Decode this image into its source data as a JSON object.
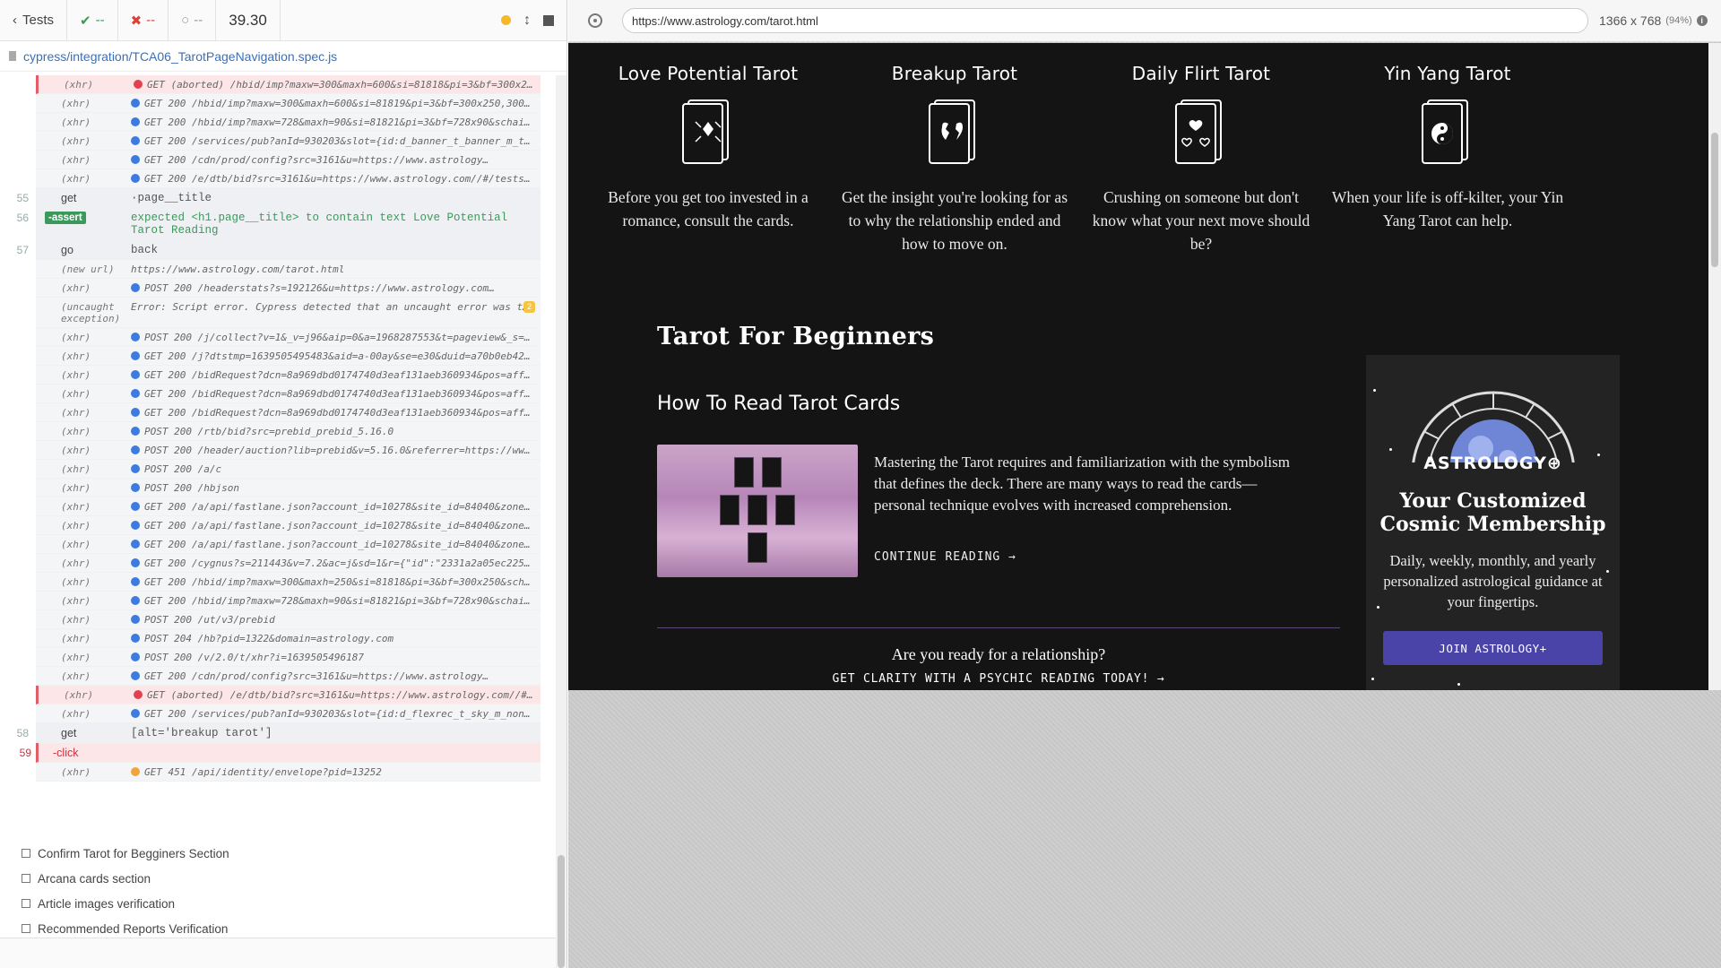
{
  "runner": {
    "back_label": "Tests",
    "passed": "--",
    "failed": "--",
    "pending": "--",
    "duration": "39.30",
    "spec_path": "cypress/integration/TCA06_TarotPageNavigation.spec.js"
  },
  "log": [
    {
      "num": "",
      "name": "(xhr)",
      "status": "red",
      "msg": "GET (aborted) /hbid/imp?maxw=300&maxh=600&si=81818&pi=3&bf=300x250,30…",
      "kind": "err"
    },
    {
      "num": "",
      "name": "(xhr)",
      "status": "blue",
      "msg": "GET 200 /hbid/imp?maxw=300&maxh=600&si=81819&pi=3&bf=300x250,300x600&…"
    },
    {
      "num": "",
      "name": "(xhr)",
      "status": "blue",
      "msg": "GET 200 /hbid/imp?maxw=728&maxh=90&si=81821&pi=3&bf=728x90&schain=1.0…"
    },
    {
      "num": "",
      "name": "(xhr)",
      "status": "blue",
      "msg": "GET 200 /services/pub?anId=930203&slot={id:d_banner_t_banner_m_tinyba…"
    },
    {
      "num": "",
      "name": "(xhr)",
      "status": "blue",
      "msg": "GET 200 /cdn/prod/config?src=3161&u=https://www.astrology…"
    },
    {
      "num": "",
      "name": "(xhr)",
      "status": "blue",
      "msg": "GET 200 /e/dtb/bid?src=3161&u=https://www.astrology.com//#/tests/inte…"
    },
    {
      "num": "55",
      "name": "get",
      "msg": "·page__title",
      "kind": "cmd"
    },
    {
      "num": "56",
      "name": "-assert",
      "msg": "expected <h1.page__title> to contain text Love Potential Tarot Reading",
      "kind": "assert"
    },
    {
      "num": "57",
      "name": "go",
      "msg": "back",
      "kind": "cmd"
    },
    {
      "num": "",
      "name": "(new url)",
      "status": "",
      "msg": "https://www.astrology.com/tarot.html",
      "kind": "url"
    },
    {
      "num": "",
      "name": "(xhr)",
      "status": "blue",
      "msg": "POST 200 /headerstats?s=192126&u=https://www.astrology.com…"
    },
    {
      "num": "",
      "name": "(uncaught exception)",
      "status": "",
      "msg": "Error: Script error. Cypress detected that an uncaught error was throw…",
      "count": "2",
      "kind": "exc"
    },
    {
      "num": "",
      "name": "(xhr)",
      "status": "blue",
      "msg": "POST 200 /j/collect?v=1&_v=j96&aip=0&a=1968287553&t=pageview&_s=1&dl=…"
    },
    {
      "num": "",
      "name": "(xhr)",
      "status": "blue",
      "msg": "GET 200 /j?dtstmp=1639505495483&aid=a-00ay&se=e30&duid=a70b0eb4253c-…"
    },
    {
      "num": "",
      "name": "(xhr)",
      "status": "blue",
      "msg": "GET 200 /bidRequest?dcn=8a969dbd0174740d3eaf131aeb360934&pos=affiliat…"
    },
    {
      "num": "",
      "name": "(xhr)",
      "status": "blue",
      "msg": "GET 200 /bidRequest?dcn=8a969dbd0174740d3eaf131aeb360934&pos=affiliat…"
    },
    {
      "num": "",
      "name": "(xhr)",
      "status": "blue",
      "msg": "GET 200 /bidRequest?dcn=8a969dbd0174740d3eaf131aeb360934&pos=affiliat…"
    },
    {
      "num": "",
      "name": "(xhr)",
      "status": "blue",
      "msg": "POST 200 /rtb/bid?src=prebid_prebid_5.16.0"
    },
    {
      "num": "",
      "name": "(xhr)",
      "status": "blue",
      "msg": "POST 200 /header/auction?lib=prebid&v=5.16.0&referrer=https://www.ast…"
    },
    {
      "num": "",
      "name": "(xhr)",
      "status": "blue",
      "msg": "POST 200 /a/c"
    },
    {
      "num": "",
      "name": "(xhr)",
      "status": "blue",
      "msg": "POST 200 /hbjson"
    },
    {
      "num": "",
      "name": "(xhr)",
      "status": "blue",
      "msg": "GET 200 /a/api/fastlane.json?account_id=10278&site_id=84040&zone_id=7…"
    },
    {
      "num": "",
      "name": "(xhr)",
      "status": "blue",
      "msg": "GET 200 /a/api/fastlane.json?account_id=10278&site_id=84040&zone_id=7…"
    },
    {
      "num": "",
      "name": "(xhr)",
      "status": "blue",
      "msg": "GET 200 /a/api/fastlane.json?account_id=10278&site_id=84040&zone_id=7…"
    },
    {
      "num": "",
      "name": "(xhr)",
      "status": "blue",
      "msg": "GET 200 /cygnus?s=211443&v=7.2&ac=j&sd=1&r={\"id\":\"2331a2a05ec2258\",\"s…"
    },
    {
      "num": "",
      "name": "(xhr)",
      "status": "blue",
      "msg": "GET 200 /hbid/imp?maxw=300&maxh=250&si=81818&pi=3&bf=300x250&schain=1…"
    },
    {
      "num": "",
      "name": "(xhr)",
      "status": "blue",
      "msg": "GET 200 /hbid/imp?maxw=728&maxh=90&si=81821&pi=3&bf=728x90&schain=1.0…"
    },
    {
      "num": "",
      "name": "(xhr)",
      "status": "blue",
      "msg": "POST 200 /ut/v3/prebid"
    },
    {
      "num": "",
      "name": "(xhr)",
      "status": "blue",
      "msg": "POST 204 /hb?pid=1322&domain=astrology.com"
    },
    {
      "num": "",
      "name": "(xhr)",
      "status": "blue",
      "msg": "POST 200 /v/2.0/t/xhr?i=1639505496187"
    },
    {
      "num": "",
      "name": "(xhr)",
      "status": "blue",
      "msg": "GET 200 /cdn/prod/config?src=3161&u=https://www.astrology…"
    },
    {
      "num": "",
      "name": "(xhr)",
      "status": "red",
      "msg": "GET (aborted) /e/dtb/bid?src=3161&u=https://www.astrology.com//#/test…",
      "kind": "err"
    },
    {
      "num": "",
      "name": "(xhr)",
      "status": "blue",
      "msg": "GET 200 /services/pub?anId=930203&slot={id:d_flexrec_t_sky_m_none_1,s…"
    },
    {
      "num": "58",
      "name": "get",
      "msg": "[alt='breakup tarot']",
      "kind": "cmd"
    },
    {
      "num": "59",
      "name": "-click",
      "msg": "",
      "kind": "click"
    },
    {
      "num": "",
      "name": "(xhr)",
      "status": "orange",
      "msg": "GET 451 /api/identity/envelope?pid=13252"
    }
  ],
  "tests": [
    "Confirm Tarot for Begginers Section",
    "Arcana cards section",
    "Article images verification",
    "Recommended Reports Verification"
  ],
  "browser": {
    "url": "https://www.astrology.com/tarot.html",
    "viewport": "1366 x 768",
    "scale": "(94%)"
  },
  "page": {
    "cards": [
      {
        "title": "Love Potential Tarot",
        "desc": "Before you get too invested in a romance, consult the cards.",
        "icon": "love-tarot-card-icon"
      },
      {
        "title": "Breakup Tarot",
        "desc": "Get the insight you're looking for as to why the relationship ended and how to move on.",
        "icon": "breakup-tarot-card-icon"
      },
      {
        "title": "Daily Flirt Tarot",
        "desc": "Crushing on someone but don't know what your next move should be?",
        "icon": "flirt-tarot-card-icon"
      },
      {
        "title": "Yin Yang Tarot",
        "desc": "When your life is off-kilter, your Yin Yang Tarot can help.",
        "icon": "yin-yang-tarot-card-icon"
      }
    ],
    "section_title": "Tarot For Beginners",
    "article": {
      "title": "How To Read Tarot Cards",
      "text": "Mastering the Tarot requires and familiarization with the symbolism that defines the deck. There are many ways to read the cards—personal technique evolves with increased comprehension.",
      "cta": "CONTINUE READING →"
    },
    "ready_text": "Are you ready for a relationship?",
    "clarity_link": "GET CLARITY WITH A PSYCHIC READING TODAY! →",
    "promo": {
      "brand": "ASTROLOGY⊕",
      "title": "Your Customized Cosmic Membership",
      "text": "Daily, weekly, monthly, and yearly personalized astrological guidance at your fingertips.",
      "button": "JOIN ASTROLOGY+"
    }
  },
  "colors": {
    "pass": "#3d9a56",
    "fail": "#d8423a",
    "page_bg": "#141414",
    "promo_button": "#4a44a8"
  }
}
